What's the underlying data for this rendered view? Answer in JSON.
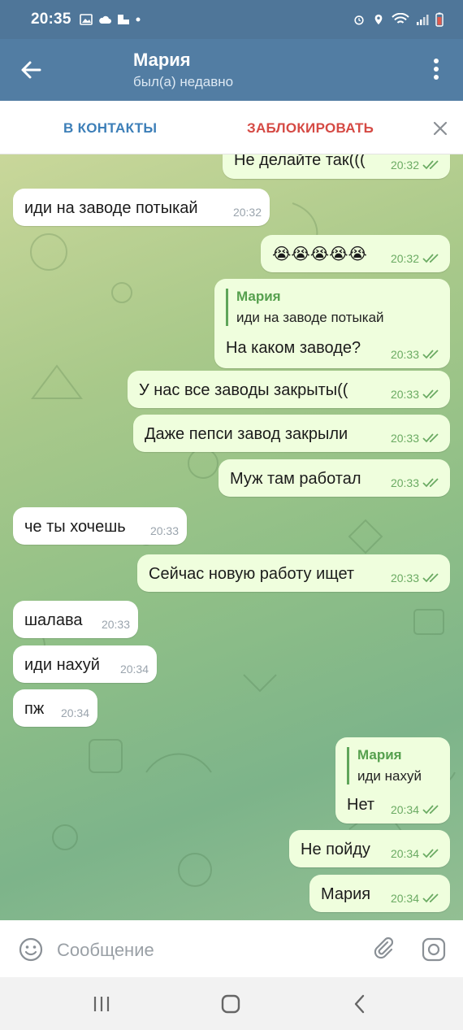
{
  "status_bar": {
    "time": "20:35"
  },
  "header": {
    "title": "Мария",
    "subtitle": "был(а) недавно"
  },
  "actions": {
    "add_contact": "В КОНТАКТЫ",
    "block": "ЗАБЛОКИРОВАТЬ"
  },
  "messages": [
    {
      "dir": "out",
      "text": "Не делайте так(((",
      "time": "20:32"
    },
    {
      "dir": "in",
      "text": "иди на заводе потыкай",
      "time": "20:32"
    },
    {
      "dir": "out",
      "text": "😭😭😭😭😭",
      "time": "20:32"
    },
    {
      "dir": "out",
      "text": "На каком заводе?",
      "time": "20:33",
      "reply_name": "Мария",
      "reply_text": "иди на заводе потыкай"
    },
    {
      "dir": "out",
      "text": "У нас все заводы закрыты((",
      "time": "20:33"
    },
    {
      "dir": "out",
      "text": "Даже пепси завод закрыли",
      "time": "20:33"
    },
    {
      "dir": "out",
      "text": "Муж там работал",
      "time": "20:33"
    },
    {
      "dir": "in",
      "text": "че ты хочешь",
      "time": "20:33"
    },
    {
      "dir": "out",
      "text": "Сейчас новую работу ищет",
      "time": "20:33"
    },
    {
      "dir": "in",
      "text": "шалава",
      "time": "20:33"
    },
    {
      "dir": "in",
      "text": "иди нахуй",
      "time": "20:34"
    },
    {
      "dir": "in",
      "text": "пж",
      "time": "20:34"
    },
    {
      "dir": "out",
      "text": "Нет",
      "time": "20:34",
      "reply_name": "Мария",
      "reply_text": "иди нахуй"
    },
    {
      "dir": "out",
      "text": "Не пойду",
      "time": "20:34"
    },
    {
      "dir": "out",
      "text": "Мария",
      "time": "20:34"
    }
  ],
  "input": {
    "placeholder": "Сообщение"
  },
  "colors": {
    "header": "#527da3",
    "outgoing_bubble": "#effedd",
    "incoming_bubble": "#ffffff",
    "read_check": "#6bab63",
    "block_red": "#d54a44",
    "contacts_blue": "#3d7fb8"
  },
  "icons": [
    "back-arrow-icon",
    "more-vert-icon",
    "close-icon",
    "emoji-icon",
    "attach-icon",
    "camera-icon",
    "double-check-icon"
  ]
}
